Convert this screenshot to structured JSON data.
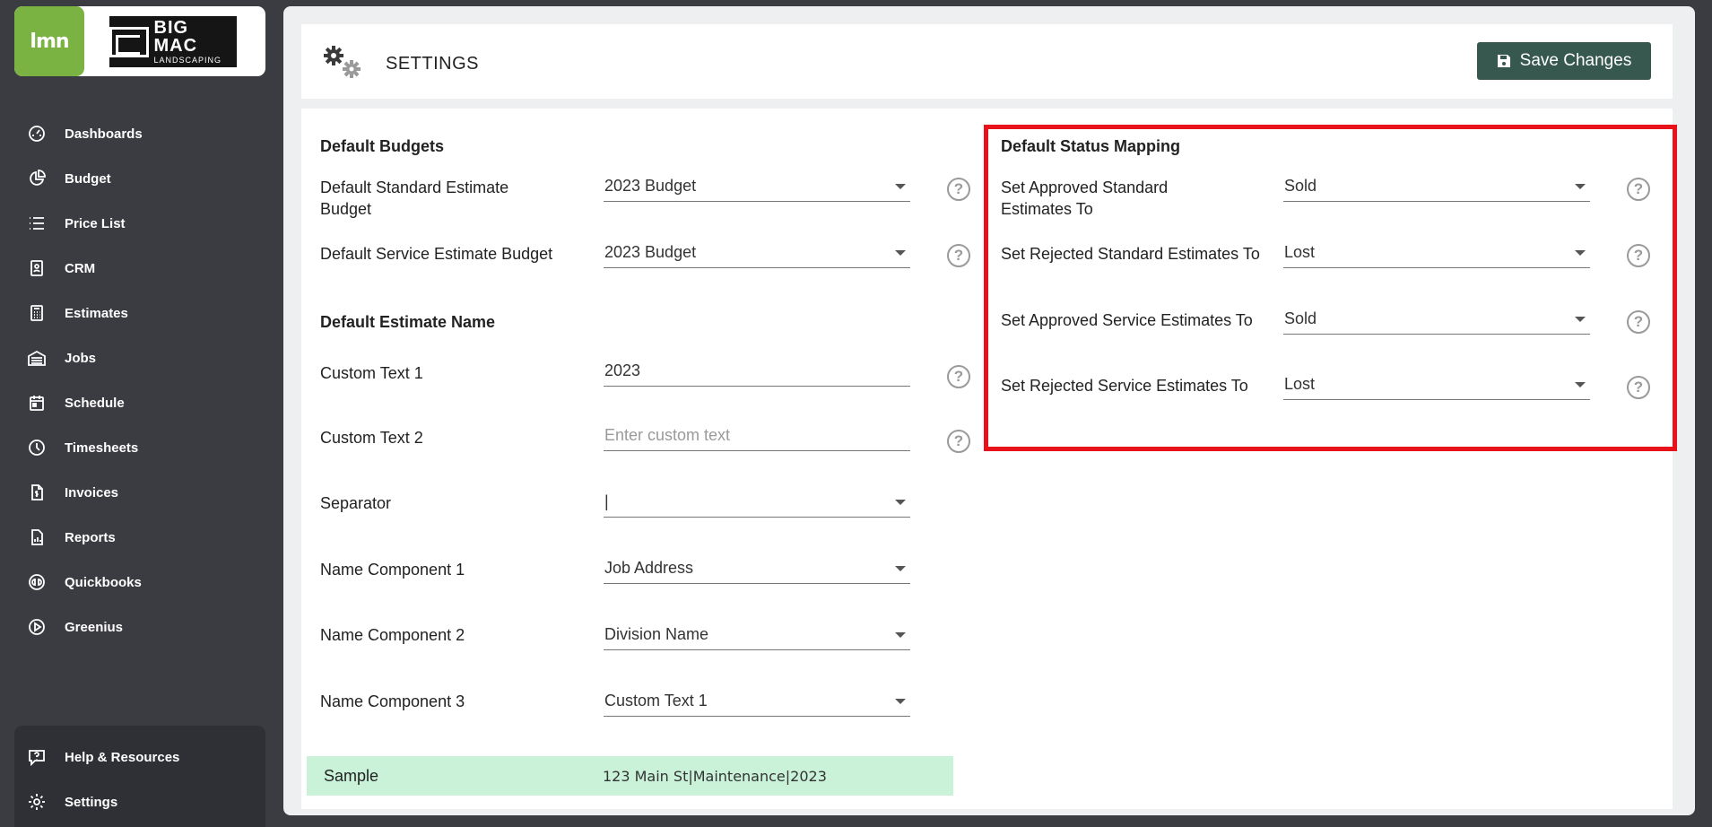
{
  "brand": {
    "lmn_logo": "lmn",
    "company_line1": "BIG MAC",
    "company_line2": "LANDSCAPING"
  },
  "sidebar": {
    "items": [
      {
        "label": "Dashboards",
        "icon": "dashboard-gauge-icon"
      },
      {
        "label": "Budget",
        "icon": "pie-chart-icon"
      },
      {
        "label": "Price List",
        "icon": "list-icon"
      },
      {
        "label": "CRM",
        "icon": "contact-card-icon"
      },
      {
        "label": "Estimates",
        "icon": "calculator-icon"
      },
      {
        "label": "Jobs",
        "icon": "garage-icon"
      },
      {
        "label": "Schedule",
        "icon": "calendar-icon"
      },
      {
        "label": "Timesheets",
        "icon": "clock-icon"
      },
      {
        "label": "Invoices",
        "icon": "invoice-icon"
      },
      {
        "label": "Reports",
        "icon": "report-icon"
      },
      {
        "label": "Quickbooks",
        "icon": "quickbooks-icon"
      },
      {
        "label": "Greenius",
        "icon": "play-circle-icon"
      }
    ],
    "bottom": [
      {
        "label": "Help & Resources",
        "icon": "help-chat-icon"
      },
      {
        "label": "Settings",
        "icon": "gear-icon"
      }
    ]
  },
  "header": {
    "title": "SETTINGS",
    "save_label": "Save Changes"
  },
  "budgets": {
    "title": "Default Budgets",
    "standard": {
      "label": "Default Standard Estimate Budget",
      "value": "2023 Budget"
    },
    "service": {
      "label": "Default Service Estimate Budget",
      "value": "2023 Budget"
    }
  },
  "estimate_name": {
    "title": "Default Estimate Name",
    "custom1": {
      "label": "Custom Text 1",
      "value": "2023"
    },
    "custom2": {
      "label": "Custom Text 2",
      "placeholder": "Enter custom text"
    },
    "separator": {
      "label": "Separator",
      "value": "|"
    },
    "comp1": {
      "label": "Name Component 1",
      "value": "Job Address"
    },
    "comp2": {
      "label": "Name Component 2",
      "value": "Division Name"
    },
    "comp3": {
      "label": "Name Component 3",
      "value": "Custom Text 1"
    },
    "sample": {
      "label": "Sample",
      "value": "123 Main St|Maintenance|2023"
    }
  },
  "status_mapping": {
    "title": "Default Status Mapping",
    "approved_standard": {
      "label": "Set Approved Standard Estimates To",
      "value": "Sold"
    },
    "rejected_standard": {
      "label": "Set Rejected Standard Estimates To",
      "value": "Lost"
    },
    "approved_service": {
      "label": "Set Approved Service Estimates To",
      "value": "Sold"
    },
    "rejected_service": {
      "label": "Set Rejected Service Estimates To",
      "value": "Lost"
    }
  },
  "help_glyph": "?",
  "colors": {
    "accent_green": "#7ab342",
    "save_button": "#37584e",
    "sample_bg": "#c9f2d9",
    "highlight_red": "#e8121b",
    "sidebar_bg": "#3b3c42"
  }
}
